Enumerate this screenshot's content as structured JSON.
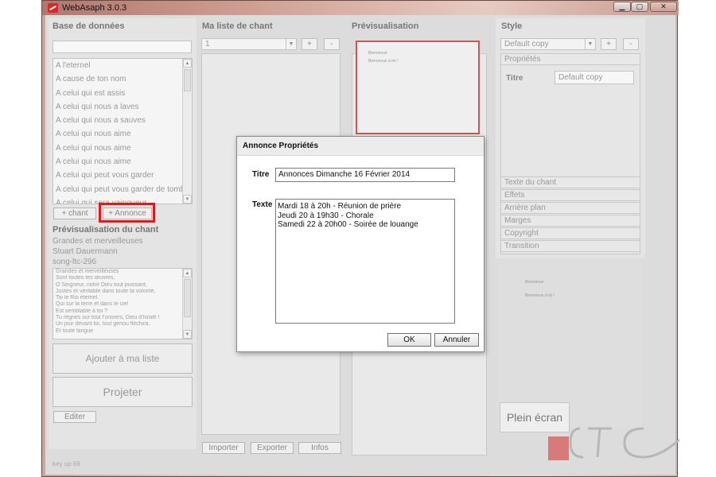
{
  "window": {
    "title": "WebAsaph 3.0.3",
    "min": "▁",
    "max": "▢",
    "close": "✕"
  },
  "left": {
    "header": "Base de données",
    "songs": [
      "A l'eternel",
      "A cause de ton nom",
      "A celui qui est assis",
      "A celui qui nous a laves",
      "A celui qui nous a sauves",
      "A celui qui nous aime",
      "A celui qui nous aime",
      "A celui qui nous aime",
      "A celui qui peut vous garder",
      "A celui qui peut vous garder de tombe",
      "A celui qui sera vainqueur"
    ],
    "add_song": "+ chant",
    "add_announce": "+ Annonce",
    "preview_header": "Prévisualisation du chant",
    "song_title": "Grandes et merveilleuses",
    "song_author": "Stuart Dauermann",
    "song_id": "song-ltc-296",
    "song_lines": [
      "Grandes et merveilleuses",
      "Sont toutes tes œuvres,",
      "Ô Seigneur, notre Dieu tout puissant,",
      "Justes et véritable dans toute ta volonté,",
      "Toi le Roi éternel.",
      "Qui sur la terre et dans le ciel",
      "Est semblable à toi ?",
      "Tu règnes sur tout l'univers, Dieu d'Israël !",
      "Un jour devant toi, tout genou fléchira,",
      "Et toute langue"
    ],
    "add_to_list": "Ajouter à ma liste",
    "project": "Projeter",
    "edit": "Editer"
  },
  "mylist": {
    "header": "Ma liste de chant",
    "selected": "1",
    "plus": "+",
    "minus": "-",
    "import": "Importer",
    "export": "Exporter",
    "info": "Infos"
  },
  "preview": {
    "header": "Prévisualisation",
    "line1": "Bienvenue",
    "line2": "Bienvenue à toi !"
  },
  "style": {
    "header": "Style",
    "selected": "Default copy",
    "plus": "+",
    "minus": "-",
    "properties_tab": "Propriétés",
    "title_label": "Titre",
    "title_value": "Default copy",
    "sections": [
      "Texte du chant",
      "Effets",
      "Arrière plan",
      "Marges",
      "Copyright",
      "Transition"
    ],
    "small_preview_line1": "Bienvenue",
    "small_preview_line2": "Bienvenue à toi !",
    "fullscreen": "Plein écran"
  },
  "status": "key up 69",
  "dialog": {
    "title": "Annonce Propriétés",
    "title_label": "Titre",
    "title_value": "Annonces Dimanche 16 Février 2014",
    "text_label": "Texte",
    "text_lines": [
      "Mardi 18 à 20h - Réunion de prière",
      "Jeudi 20 à 19h30 - Chorale",
      "Samedi 22 à 20h00 - Soirée de louange"
    ],
    "ok": "OK",
    "cancel": "Annuler"
  },
  "colors": {
    "highlight": "#e0191d",
    "accent_red": "#d42a2a"
  },
  "icons": [
    "webasaph-logo-icon",
    "chevron-down-icon",
    "scroll-up-icon",
    "scroll-down-icon"
  ]
}
